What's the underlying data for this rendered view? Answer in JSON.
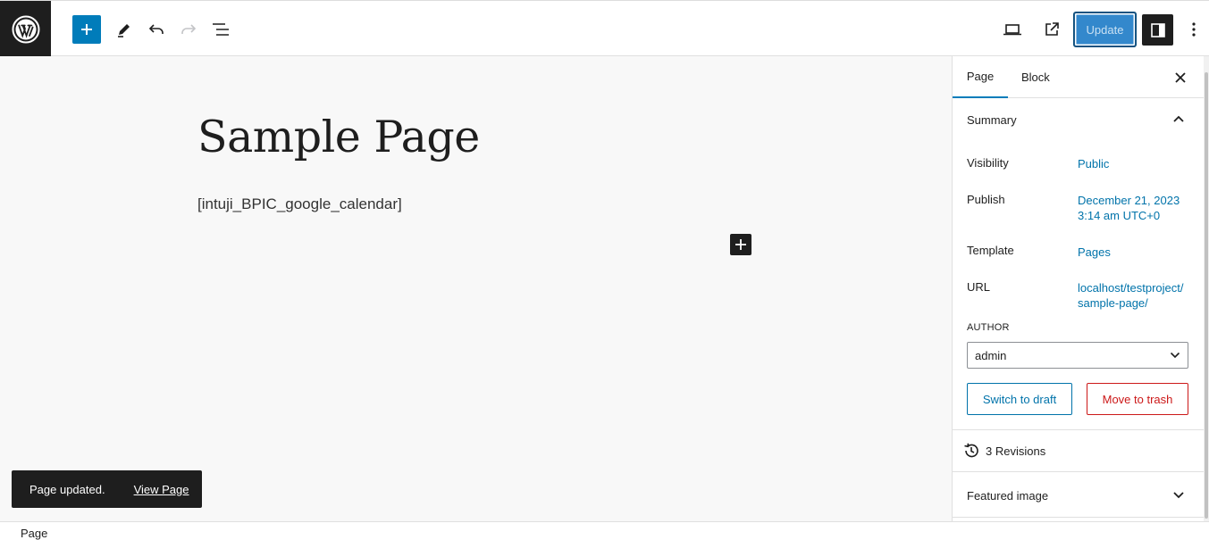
{
  "toolbar": {
    "update_label": "Update"
  },
  "editor": {
    "title": "Sample Page",
    "shortcode": "[intuji_BPIC_google_calendar]"
  },
  "snackbar": {
    "message": "Page updated.",
    "link": "View Page"
  },
  "sidebar": {
    "tabs": [
      {
        "label": "Page",
        "active": true
      },
      {
        "label": "Block",
        "active": false
      }
    ],
    "summary": {
      "title": "Summary",
      "rows": [
        {
          "label": "Visibility",
          "value": "Public"
        },
        {
          "label": "Publish",
          "value": "December 21, 2023 3:14 am UTC+0"
        },
        {
          "label": "Template",
          "value": "Pages"
        },
        {
          "label": "URL",
          "value": "localhost/testproject/sample-page/"
        }
      ],
      "author_label": "AUTHOR",
      "author_value": "admin",
      "switch_draft_label": "Switch to draft",
      "trash_label": "Move to trash"
    },
    "revisions_label": "3 Revisions",
    "featured_image_label": "Featured image"
  },
  "footer": {
    "breadcrumb": "Page"
  },
  "colors": {
    "accent": "#007cba",
    "link": "#0073aa",
    "danger": "#cc1818",
    "dark": "#1e1e1e"
  }
}
